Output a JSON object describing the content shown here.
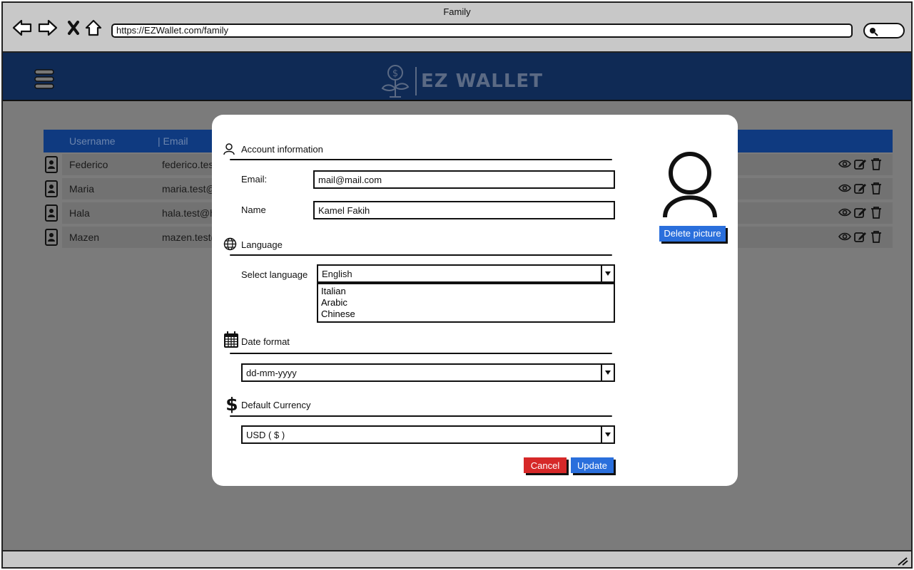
{
  "window": {
    "title": "Family"
  },
  "browser": {
    "url": "https://EZWallet.com/family"
  },
  "brand": {
    "name": "EZ WALLET",
    "colors": {
      "header": "#0f2a55",
      "accent": "#2a6fdc",
      "danger": "#d62828"
    }
  },
  "table": {
    "columns": [
      "Username",
      "| Email"
    ],
    "rows": [
      {
        "username": "Federico",
        "email": "federico.tes"
      },
      {
        "username": "Maria",
        "email": "maria.test@"
      },
      {
        "username": "Hala",
        "email": "hala.test@h"
      },
      {
        "username": "Mazen",
        "email": "mazen.test("
      }
    ]
  },
  "modal": {
    "account": {
      "title": "Account information",
      "email_label": "Email:",
      "email_value": "mail@mail.com",
      "name_label": "Name",
      "name_value": "Kamel Fakih"
    },
    "language": {
      "title": "Language",
      "select_label": "Select language",
      "selected": "English",
      "options": [
        "Italian",
        "Arabic",
        "Chinese"
      ]
    },
    "date_format": {
      "title": "Date format",
      "selected": "dd-mm-yyyy"
    },
    "currency": {
      "title": "Default Currency",
      "selected": "USD ( $ )"
    },
    "delete_picture_label": "Delete picture",
    "cancel_label": "Cancel",
    "update_label": "Update"
  }
}
